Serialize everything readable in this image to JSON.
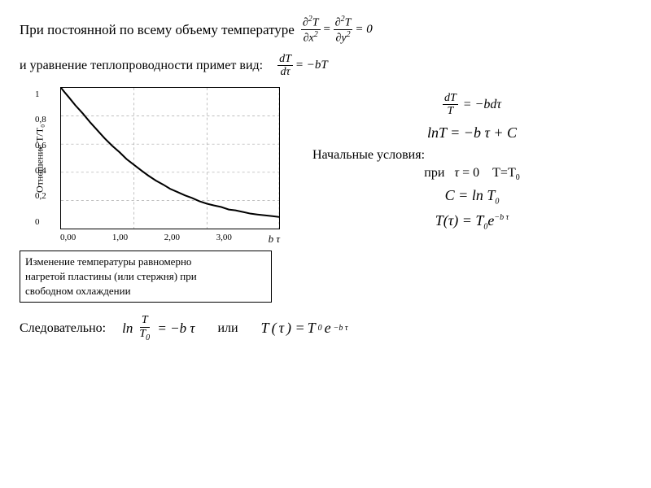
{
  "line1": {
    "text": "При постоянной по  всему  объему  температуре",
    "formula_top": "∂²T/∂x² = ∂²T/∂y² = 0"
  },
  "line2": {
    "text": "и уравнение теплопроводности примет  вид:",
    "formula": "dT/dτ = −bT"
  },
  "chart": {
    "y_label": "Отношение T/T₀",
    "x_label": "b τ",
    "x_ticks": [
      "0,00",
      "1,00",
      "2,00",
      "3,00"
    ],
    "y_ticks": [
      "0",
      "0,2",
      "0,4",
      "0,6",
      "0,8",
      "1"
    ]
  },
  "caption": {
    "line1": "Изменение  температуры равномерно",
    "line2": "нагретой пластины (или  стержня) при",
    "line3": "свободном  охлаждении"
  },
  "right_col": {
    "formula1": "dT/T = −b dτ",
    "formula2": "ln T = −b τ + C",
    "initial_cond_label": "Начальные  условия:",
    "initial_cond": "при  τ = 0   T=T₀",
    "formula3": "C = ln T₀",
    "formula4": "T(τ) = T₀e^(−b τ)"
  },
  "bottom": {
    "label": "Следовательно:",
    "formula1": "ln T/T₀ = −b τ",
    "or_label": "или",
    "formula2": "T(τ) = T₀e^(−b τ)"
  }
}
